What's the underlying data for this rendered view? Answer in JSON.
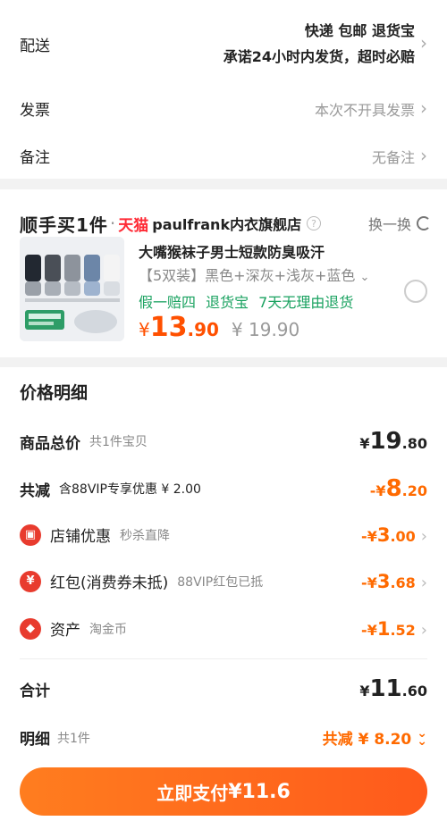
{
  "delivery": {
    "label": "配送",
    "line1": "快递 包邮 退货宝",
    "line2": "承诺24小时内发货，超时必赔"
  },
  "invoice": {
    "label": "发票",
    "value": "本次不开具发票"
  },
  "remark": {
    "label": "备注",
    "value": "无备注"
  },
  "shop": {
    "brand": "顺手买1件",
    "tmall": "天猫",
    "name": "paulfrank内衣旗舰店",
    "swap_label": "换一换"
  },
  "product": {
    "title": "大嘴猴袜子男士短款防臭吸汗",
    "spec": "【5双装】黑色+深灰+浅灰+蓝色",
    "tags": "假一赔四 退货宝 7天无理由退货",
    "price_currency": "¥",
    "price_int": "13",
    "price_dec": ".90",
    "original_price": "¥ 19.90"
  },
  "price_detail": {
    "title": "价格明细",
    "total_goods": {
      "label": "商品总价",
      "sub": "共1件宝贝",
      "cur": "¥",
      "int": "19",
      "dec": ".80"
    },
    "total_discount": {
      "label": "共减",
      "sub": "含88VIP专享优惠 ¥ 2.00",
      "cur": "-¥",
      "int": "8",
      "dec": ".20"
    },
    "shop_discount": {
      "label": "店铺优惠",
      "sub": "秒杀直降",
      "cur": "-¥",
      "int": "3",
      "dec": ".00"
    },
    "red_packet": {
      "label": "红包(消费券未抵)",
      "sub": "88VIP红包已抵",
      "cur": "-¥",
      "int": "3",
      "dec": ".68"
    },
    "assets": {
      "label": "资产",
      "sub": "淘金币",
      "cur": "-¥",
      "int": "1",
      "dec": ".52"
    },
    "sum": {
      "label": "合计",
      "cur": "¥",
      "int": "11",
      "dec": ".60"
    }
  },
  "bottom": {
    "detail_label": "明细",
    "detail_sub": "共1件",
    "saved": "共减 ¥ 8.20",
    "pay_label": "立即支付",
    "pay_amount": "¥11.6"
  },
  "colors": {
    "accent": "#ff6a00",
    "price": "#ff5000",
    "green": "#1aa260",
    "tmall": "#ff2b36"
  }
}
